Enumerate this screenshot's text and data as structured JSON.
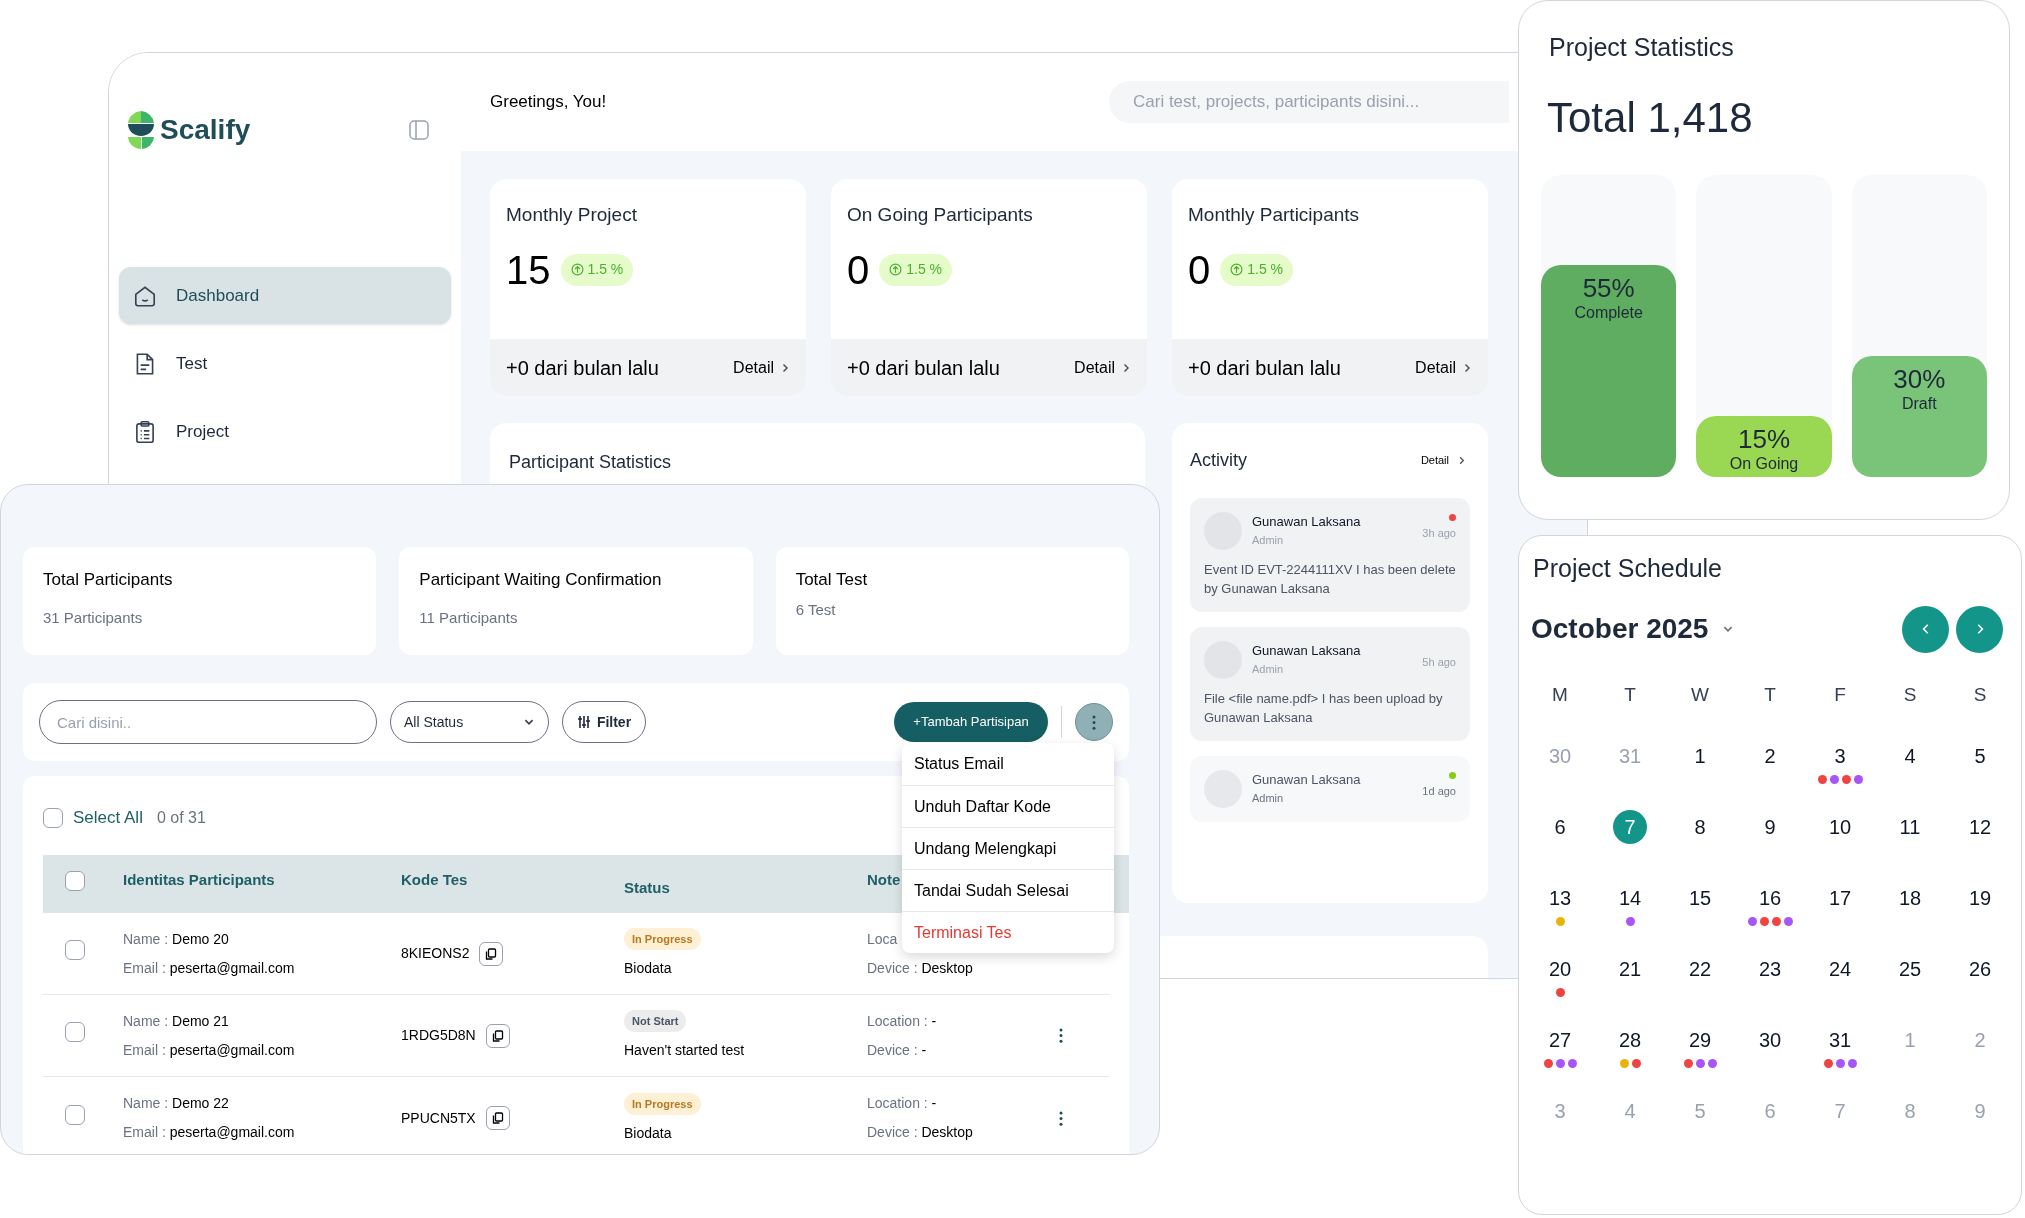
{
  "sidebar": {
    "brand": "Scalify",
    "items": [
      {
        "label": "Dashboard",
        "selected": true
      },
      {
        "label": "Test",
        "selected": false
      },
      {
        "label": "Project",
        "selected": false
      }
    ]
  },
  "header": {
    "greeting": "Greetings, You!",
    "search": {
      "placeholder": "Cari test, projects, participants disini..."
    }
  },
  "metric_cards": [
    {
      "title": "Monthly Project",
      "value": "15",
      "change": "1.5 %",
      "footer": "+0 dari bulan lalu",
      "link": "Detail"
    },
    {
      "title": "On Going Participants",
      "value": "0",
      "change": "1.5 %",
      "footer": "+0 dari bulan lalu",
      "link": "Detail"
    },
    {
      "title": "Monthly Participants",
      "value": "0",
      "change": "1.5 %",
      "footer": "+0 dari bulan lalu",
      "link": "Detail"
    }
  ],
  "participant_statistics": {
    "title": "Participant Statistics"
  },
  "activity": {
    "title": "Activity",
    "link": "Detail",
    "items": [
      {
        "name": "Gunawan Laksana",
        "role": "Admin",
        "time": "3h ago",
        "text": "Event ID EVT-2244111XV I has been delete by Gunawan Laksana",
        "color": "#ef4444",
        "faded": false
      },
      {
        "name": "Gunawan Laksana",
        "role": "Admin",
        "time": "5h ago",
        "text": "File <file name.pdf> I has been upload by Gunawan Laksana",
        "faded": false
      },
      {
        "name": "Gunawan Laksana",
        "role": "Admin",
        "time": "1d ago",
        "color": "#84cc16",
        "faded": true
      }
    ]
  },
  "participants_panel": {
    "summary_cards": [
      {
        "title": "Total Participants",
        "value": "31 Participants"
      },
      {
        "title": "Participant Waiting Confirmation",
        "value": "11 Participants"
      },
      {
        "title": "Total Test",
        "value": "6 Test"
      }
    ],
    "toolbar": {
      "search": {
        "placeholder": "Cari disini.."
      },
      "status_filter": "All Status",
      "filter_button": "Filter",
      "add_button": "+Tambah Partisipan"
    },
    "menu": [
      {
        "label": "Status Email",
        "kind": "normal"
      },
      {
        "label": "Unduh Daftar Kode",
        "kind": "normal"
      },
      {
        "label": "Undang Melengkapi",
        "kind": "normal"
      },
      {
        "label": "Tandai Sudah Selesai",
        "kind": "normal"
      },
      {
        "label": "Terminasi Tes",
        "kind": "danger"
      }
    ],
    "select_all": {
      "label": "Select All",
      "count": "0 of 31",
      "checked": false
    },
    "table": {
      "header_checked": false,
      "columns": [
        "Identitas Participants",
        "Kode Tes",
        "Status",
        "Note"
      ],
      "rows": [
        {
          "checked": false,
          "name_label": "Name :",
          "name": "Demo 20",
          "email_label": "Email :",
          "email": "peserta@gmail.com",
          "code": "8KIEONS2",
          "status": {
            "label": "In Progress",
            "kind": "in_progress"
          },
          "progress": "Biodata",
          "notes": [
            "Loca",
            "Device : **Desktop**"
          ],
          "menu_button": false
        },
        {
          "checked": false,
          "name_label": "Name :",
          "name": "Demo 21",
          "email_label": "Email :",
          "email": "peserta@gmail.com",
          "code": "1RDG5D8N",
          "status": {
            "label": "Not Start",
            "kind": "not_start"
          },
          "progress": "Haven't started test",
          "notes": [
            "Location : **-**",
            "Device : **-**"
          ],
          "menu_button": true
        },
        {
          "checked": false,
          "name_label": "Name :",
          "name": "Demo 22",
          "email_label": "Email :",
          "email": "peserta@gmail.com",
          "code": "PPUCN5TX",
          "status": {
            "label": "In Progress",
            "kind": "in_progress"
          },
          "progress": "Biodata",
          "notes": [
            "Location : **-**",
            "Device : **Desktop**"
          ],
          "menu_button": true
        }
      ]
    }
  },
  "project_statistics": {
    "title": "Project Statistics",
    "total": "Total 1,418",
    "bars": [
      {
        "value": "55%",
        "label": "Complete",
        "level": 0.7,
        "color": "#5fad60"
      },
      {
        "value": "15%",
        "label": "On Going",
        "level": 0.2,
        "color": "#9ad854"
      },
      {
        "value": "30%",
        "label": "Draft",
        "level": 0.4,
        "color": "#79c479"
      }
    ]
  },
  "project_schedule": {
    "title": "Project Schedule",
    "month": "October 2025",
    "weekdays": [
      "M",
      "T",
      "W",
      "T",
      "F",
      "S",
      "S"
    ],
    "weeks": [
      [
        {
          "day": "30",
          "muted": true,
          "today": false
        },
        {
          "day": "31",
          "muted": true,
          "today": false
        },
        {
          "day": "1",
          "muted": false,
          "today": false
        },
        {
          "day": "2",
          "muted": false,
          "today": false
        },
        {
          "day": "3",
          "muted": false,
          "today": false,
          "events": [
            {
              "color": "#ef4444"
            },
            {
              "color": "#a855f7"
            },
            {
              "color": "#ef4444"
            },
            {
              "color": "#a855f7"
            }
          ]
        },
        {
          "day": "4",
          "muted": false,
          "today": false
        },
        {
          "day": "5",
          "muted": false,
          "today": false
        }
      ],
      [
        {
          "day": "6",
          "muted": false,
          "today": false
        },
        {
          "day": "7",
          "muted": false,
          "today": true
        },
        {
          "day": "8",
          "muted": false,
          "today": false
        },
        {
          "day": "9",
          "muted": false,
          "today": false
        },
        {
          "day": "10",
          "muted": false,
          "today": false
        },
        {
          "day": "11",
          "muted": false,
          "today": false
        },
        {
          "day": "12",
          "muted": false,
          "today": false
        }
      ],
      [
        {
          "day": "13",
          "muted": false,
          "today": false,
          "events": [
            {
              "color": "#eab308"
            }
          ]
        },
        {
          "day": "14",
          "muted": false,
          "today": false,
          "events": [
            {
              "color": "#a855f7"
            }
          ]
        },
        {
          "day": "15",
          "muted": false,
          "today": false
        },
        {
          "day": "16",
          "muted": false,
          "today": false,
          "events": [
            {
              "color": "#a855f7"
            },
            {
              "color": "#ef4444"
            },
            {
              "color": "#ef4444"
            },
            {
              "color": "#a855f7"
            }
          ]
        },
        {
          "day": "17",
          "muted": false,
          "today": false
        },
        {
          "day": "18",
          "muted": false,
          "today": false
        },
        {
          "day": "19",
          "muted": false,
          "today": false
        }
      ],
      [
        {
          "day": "20",
          "muted": false,
          "today": false,
          "events": [
            {
              "color": "#ef4444"
            }
          ]
        },
        {
          "day": "21",
          "muted": false,
          "today": false
        },
        {
          "day": "22",
          "muted": false,
          "today": false
        },
        {
          "day": "23",
          "muted": false,
          "today": false
        },
        {
          "day": "24",
          "muted": false,
          "today": false
        },
        {
          "day": "25",
          "muted": false,
          "today": false
        },
        {
          "day": "26",
          "muted": false,
          "today": false
        }
      ],
      [
        {
          "day": "27",
          "muted": false,
          "today": false,
          "events": [
            {
              "color": "#ef4444"
            },
            {
              "color": "#a855f7"
            },
            {
              "color": "#a855f7"
            }
          ]
        },
        {
          "day": "28",
          "muted": false,
          "today": false,
          "events": [
            {
              "color": "#eab308"
            },
            {
              "color": "#ef4444"
            }
          ]
        },
        {
          "day": "29",
          "muted": false,
          "today": false,
          "events": [
            {
              "color": "#ef4444"
            },
            {
              "color": "#a855f7"
            },
            {
              "color": "#a855f7"
            }
          ]
        },
        {
          "day": "30",
          "muted": false,
          "today": false
        },
        {
          "day": "31",
          "muted": false,
          "today": false,
          "events": [
            {
              "color": "#ef4444"
            },
            {
              "color": "#a855f7"
            },
            {
              "color": "#a855f7"
            }
          ]
        },
        {
          "day": "1",
          "muted": true,
          "today": false
        },
        {
          "day": "2",
          "muted": true,
          "today": false
        }
      ],
      [
        {
          "day": "3",
          "muted": true,
          "today": false
        },
        {
          "day": "4",
          "muted": true,
          "today": false
        },
        {
          "day": "5",
          "muted": true,
          "today": false
        },
        {
          "day": "6",
          "muted": true,
          "today": false
        },
        {
          "day": "7",
          "muted": true,
          "today": false
        },
        {
          "day": "8",
          "muted": true,
          "today": false
        },
        {
          "day": "9",
          "muted": true,
          "today": false
        }
      ]
    ]
  }
}
